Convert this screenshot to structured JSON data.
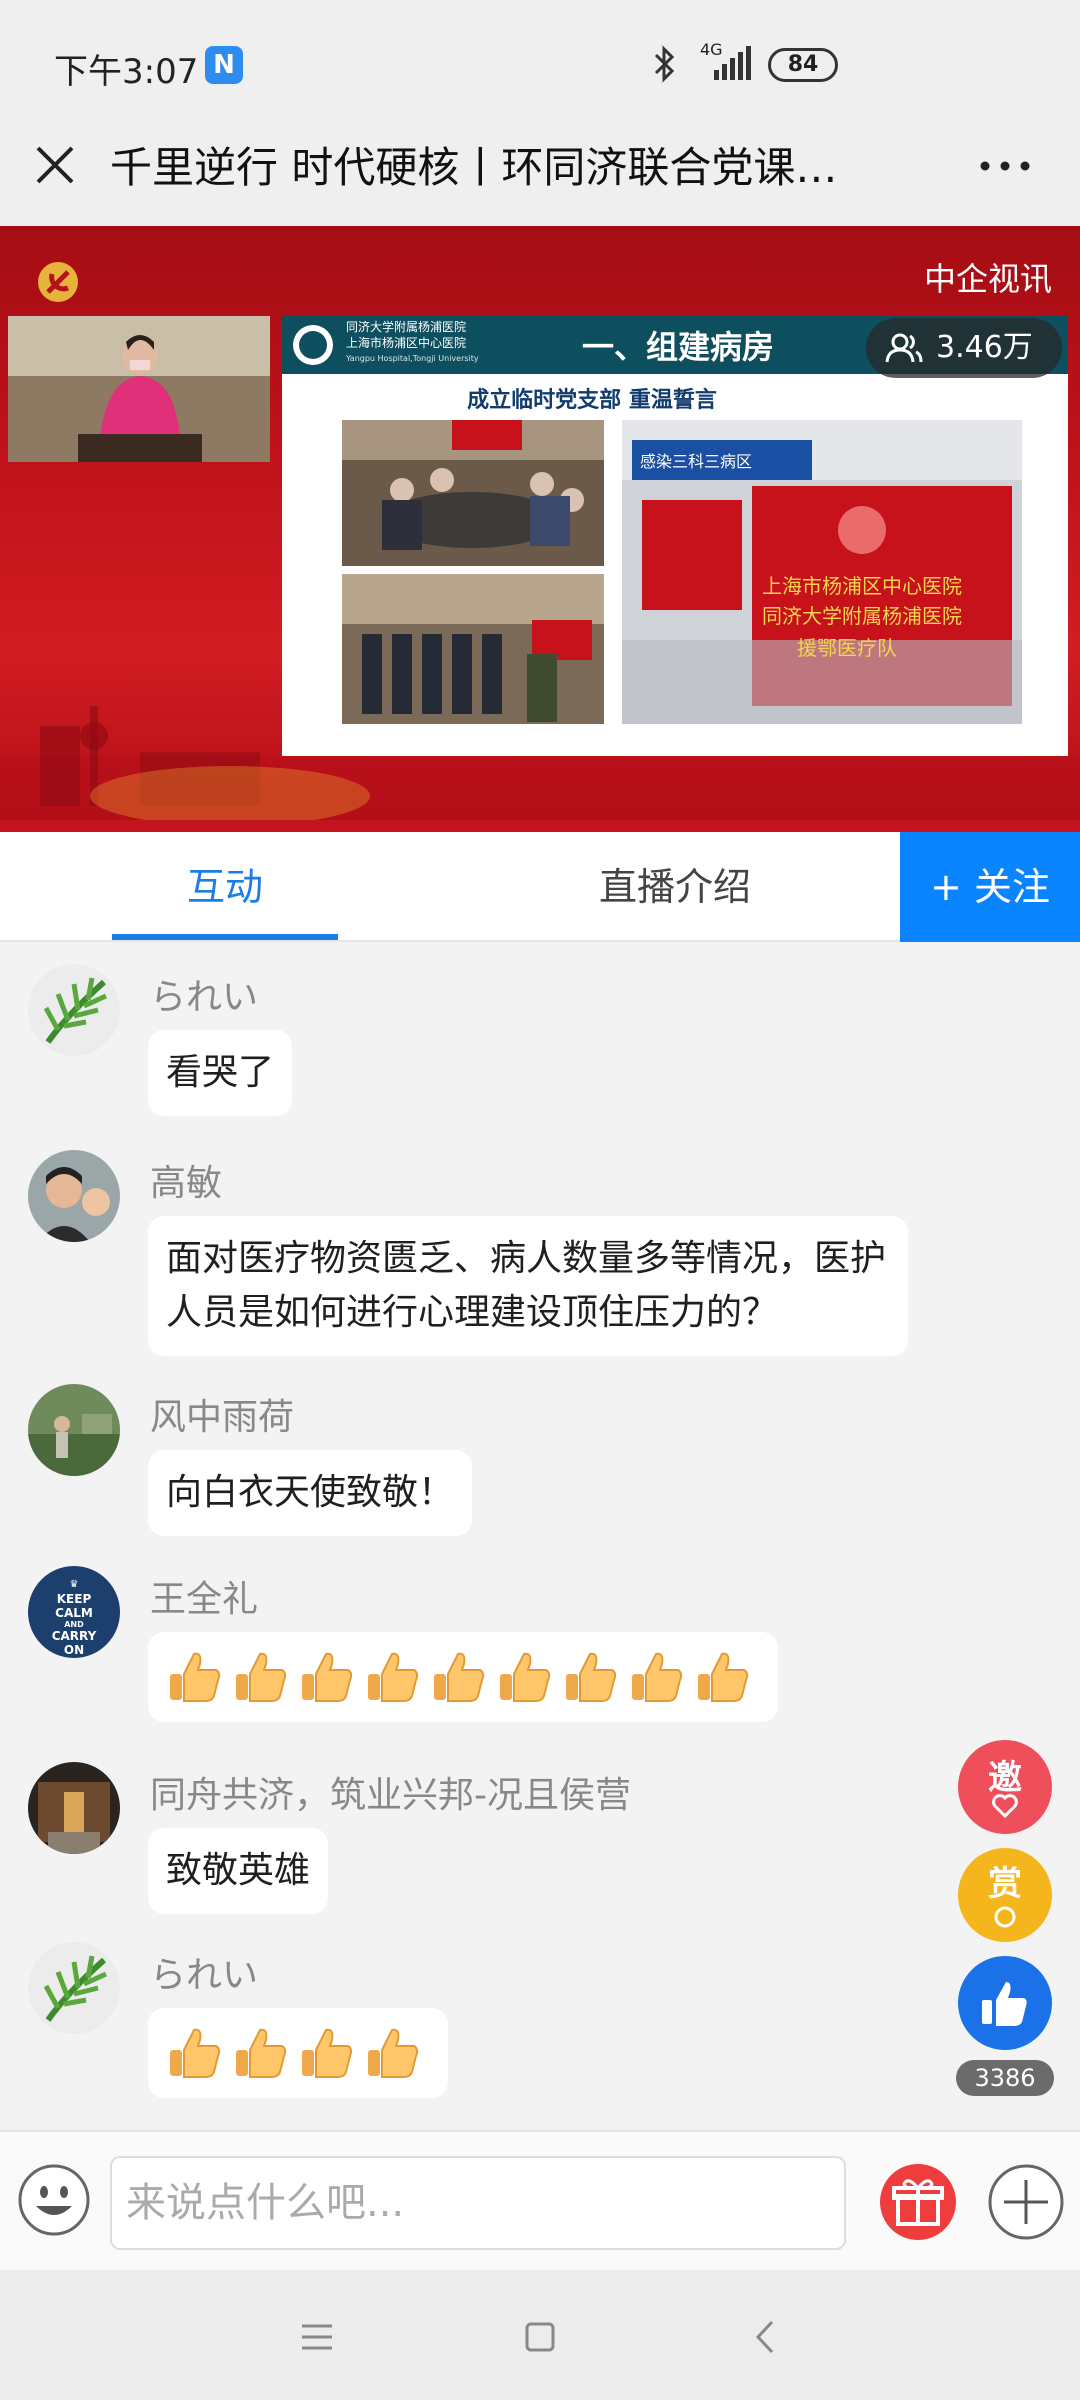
{
  "status": {
    "time": "下午3:07",
    "app_badge": "N",
    "network": "4G",
    "battery": "84"
  },
  "header": {
    "title": "千里逆行 时代硬核丨环同济联合党课…"
  },
  "video": {
    "brand": "中企视讯",
    "slide_title": "一、组建病房",
    "slide_subtitle": "成立临时党支部 重温誓言",
    "slide_hospital_line1": "同济大学附属杨浦医院",
    "slide_hospital_line2": "上海市杨浦区中心医院",
    "slide_hospital_en": "Yangpu Hospital,Tongji University",
    "ward_sign": "感染三科三病区",
    "banner_line1": "上海市杨浦区中心医院",
    "banner_line2": "同济大学附属杨浦医院",
    "banner_line3": "援鄂医疗队",
    "viewers": "3.46万"
  },
  "tabs": {
    "interact": "互动",
    "intro": "直播介绍",
    "follow": "+ 关注"
  },
  "messages": [
    {
      "name": "られい",
      "text": "看哭了"
    },
    {
      "name": "高敏",
      "text": "面对医疗物资匮乏、病人数量多等情况，医护人员是如何进行心理建设顶住压力的？"
    },
    {
      "name": "风中雨荷",
      "text": "向白衣天使致敬！"
    },
    {
      "name": "王全礼",
      "thumbs": 9
    },
    {
      "name": "同舟共济，筑业兴邦-况且侯营",
      "text": "致敬英雄"
    },
    {
      "name": "られい",
      "thumbs": 4
    }
  ],
  "avatar_keepcalm": {
    "l1": "KEEP",
    "l2": "CALM",
    "l3": "AND",
    "l4": "CARRY",
    "l5": "ON"
  },
  "side": {
    "invite": "邀",
    "reward": "赏",
    "likes": "3386"
  },
  "input": {
    "placeholder": "来说点什么吧..."
  }
}
